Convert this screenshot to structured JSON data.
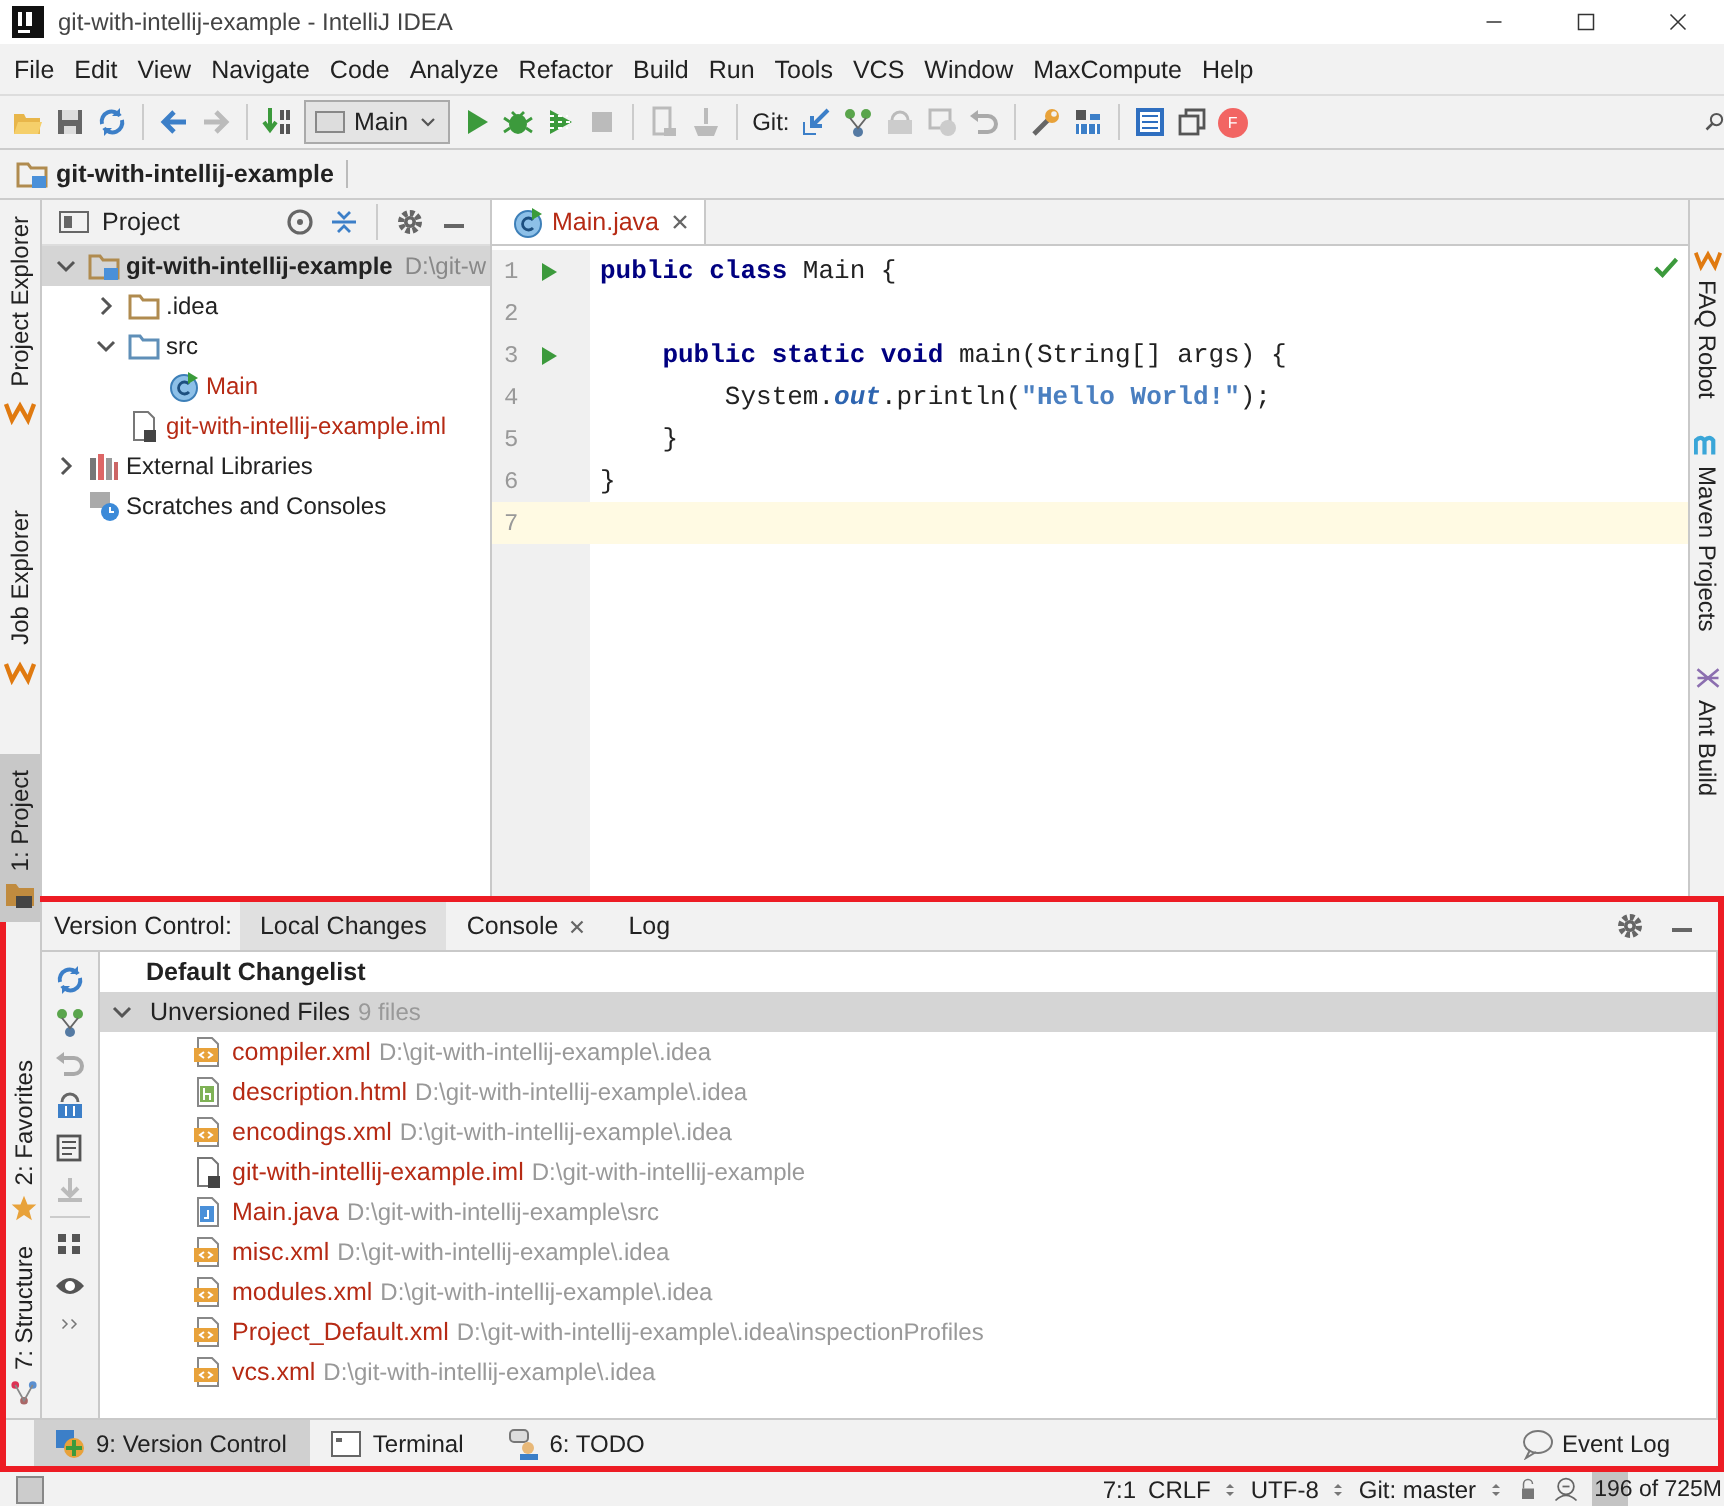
{
  "window": {
    "title": "git-with-intellij-example - IntelliJ IDEA"
  },
  "menu": [
    "File",
    "Edit",
    "View",
    "Navigate",
    "Code",
    "Analyze",
    "Refactor",
    "Build",
    "Run",
    "Tools",
    "VCS",
    "Window",
    "MaxCompute",
    "Help"
  ],
  "toolbar": {
    "run_config": "Main",
    "git_label": "Git:",
    "avatar": "F"
  },
  "breadcrumb": "git-with-intellij-example",
  "left_stripe": [
    {
      "label": "Project Explorer",
      "selected": false
    },
    {
      "label": "Job Explorer",
      "selected": false
    },
    {
      "label": "1: Project",
      "selected": true
    }
  ],
  "project_panel": {
    "title": "Project",
    "tree": [
      {
        "label": "git-with-intellij-example",
        "path": "D:\\git-w",
        "kind": "module",
        "expanded": true,
        "selected": true,
        "unversioned": false,
        "children": [
          {
            "label": ".idea",
            "kind": "folder",
            "expanded": false,
            "selected": false,
            "unversioned": false
          },
          {
            "label": "src",
            "kind": "source",
            "expanded": true,
            "selected": false,
            "unversioned": false,
            "children": [
              {
                "label": "Main",
                "kind": "class",
                "selected": false,
                "unversioned": true
              }
            ]
          },
          {
            "label": "git-with-intellij-example.iml",
            "kind": "iml",
            "selected": false,
            "unversioned": true
          }
        ]
      },
      {
        "label": "External Libraries",
        "kind": "library",
        "expanded": false,
        "selected": false,
        "unversioned": false
      },
      {
        "label": "Scratches and Consoles",
        "kind": "scratch",
        "selected": false,
        "unversioned": false
      }
    ]
  },
  "editor": {
    "tabs": [
      {
        "label": "Main.java",
        "selected": true
      }
    ],
    "lines": [
      {
        "number": "1",
        "run": true,
        "current": false,
        "tokens": [
          {
            "kind": "keyword",
            "text": "public class "
          },
          {
            "kind": "plain",
            "text": "Main {"
          }
        ]
      },
      {
        "number": "2",
        "run": false,
        "current": false
      },
      {
        "number": "3",
        "run": true,
        "current": false,
        "tokens": [
          {
            "kind": "keyword",
            "text": "    public static void "
          },
          {
            "kind": "plain",
            "text": "main(String[] args) {"
          }
        ]
      },
      {
        "number": "4",
        "run": false,
        "current": false,
        "tokens": [
          {
            "kind": "plain",
            "text": "        System."
          },
          {
            "kind": "static",
            "text": "out"
          },
          {
            "kind": "plain",
            "text": ".println("
          },
          {
            "kind": "string",
            "text": "\"Hello World!\""
          },
          {
            "kind": "plain",
            "text": ");"
          }
        ]
      },
      {
        "number": "5",
        "run": false,
        "current": false,
        "tokens": [
          {
            "kind": "plain",
            "text": "    }"
          }
        ]
      },
      {
        "number": "6",
        "run": false,
        "current": false,
        "tokens": [
          {
            "kind": "plain",
            "text": "}"
          }
        ]
      },
      {
        "number": "7",
        "run": false,
        "current": true
      }
    ]
  },
  "right_stripe": [
    {
      "label": "FAQ Robot"
    },
    {
      "label": "Maven Projects"
    },
    {
      "label": "Ant Build"
    }
  ],
  "left_stripe_bottom": [
    {
      "label": "2: Favorites"
    },
    {
      "label": "7: Structure"
    }
  ],
  "version_control": {
    "title": "Version Control:",
    "tabs": [
      {
        "label": "Local Changes",
        "selected": true,
        "closable": false
      },
      {
        "label": "Console",
        "selected": false,
        "closable": true
      },
      {
        "label": "Log",
        "selected": false,
        "closable": false
      }
    ],
    "changelist": "Default Changelist",
    "group": {
      "label": "Unversioned Files",
      "count": "9 files",
      "expanded": true,
      "files": [
        {
          "name": "compiler.xml",
          "path": "D:\\git-with-intellij-example\\.idea",
          "kind": "xml"
        },
        {
          "name": "description.html",
          "path": "D:\\git-with-intellij-example\\.idea",
          "kind": "html"
        },
        {
          "name": "encodings.xml",
          "path": "D:\\git-with-intellij-example\\.idea",
          "kind": "xml"
        },
        {
          "name": "git-with-intellij-example.iml",
          "path": "D:\\git-with-intellij-example",
          "kind": "iml"
        },
        {
          "name": "Main.java",
          "path": "D:\\git-with-intellij-example\\src",
          "kind": "java"
        },
        {
          "name": "misc.xml",
          "path": "D:\\git-with-intellij-example\\.idea",
          "kind": "xml"
        },
        {
          "name": "modules.xml",
          "path": "D:\\git-with-intellij-example\\.idea",
          "kind": "xml"
        },
        {
          "name": "Project_Default.xml",
          "path": "D:\\git-with-intellij-example\\.idea\\inspectionProfiles",
          "kind": "xml"
        },
        {
          "name": "vcs.xml",
          "path": "D:\\git-with-intellij-example\\.idea",
          "kind": "xml"
        }
      ]
    }
  },
  "bottom_tools": [
    {
      "label": "9: Version Control",
      "selected": true,
      "kind": "vcs"
    },
    {
      "label": "Terminal",
      "selected": false,
      "kind": "terminal"
    },
    {
      "label": "6: TODO",
      "selected": false,
      "kind": "todo"
    }
  ],
  "event_log": "Event Log",
  "status_bar": {
    "position": "7:1",
    "line_separator": "CRLF",
    "encoding": "UTF-8",
    "branch": "Git: master",
    "memory": "196 of 725M",
    "level": 0.27
  }
}
